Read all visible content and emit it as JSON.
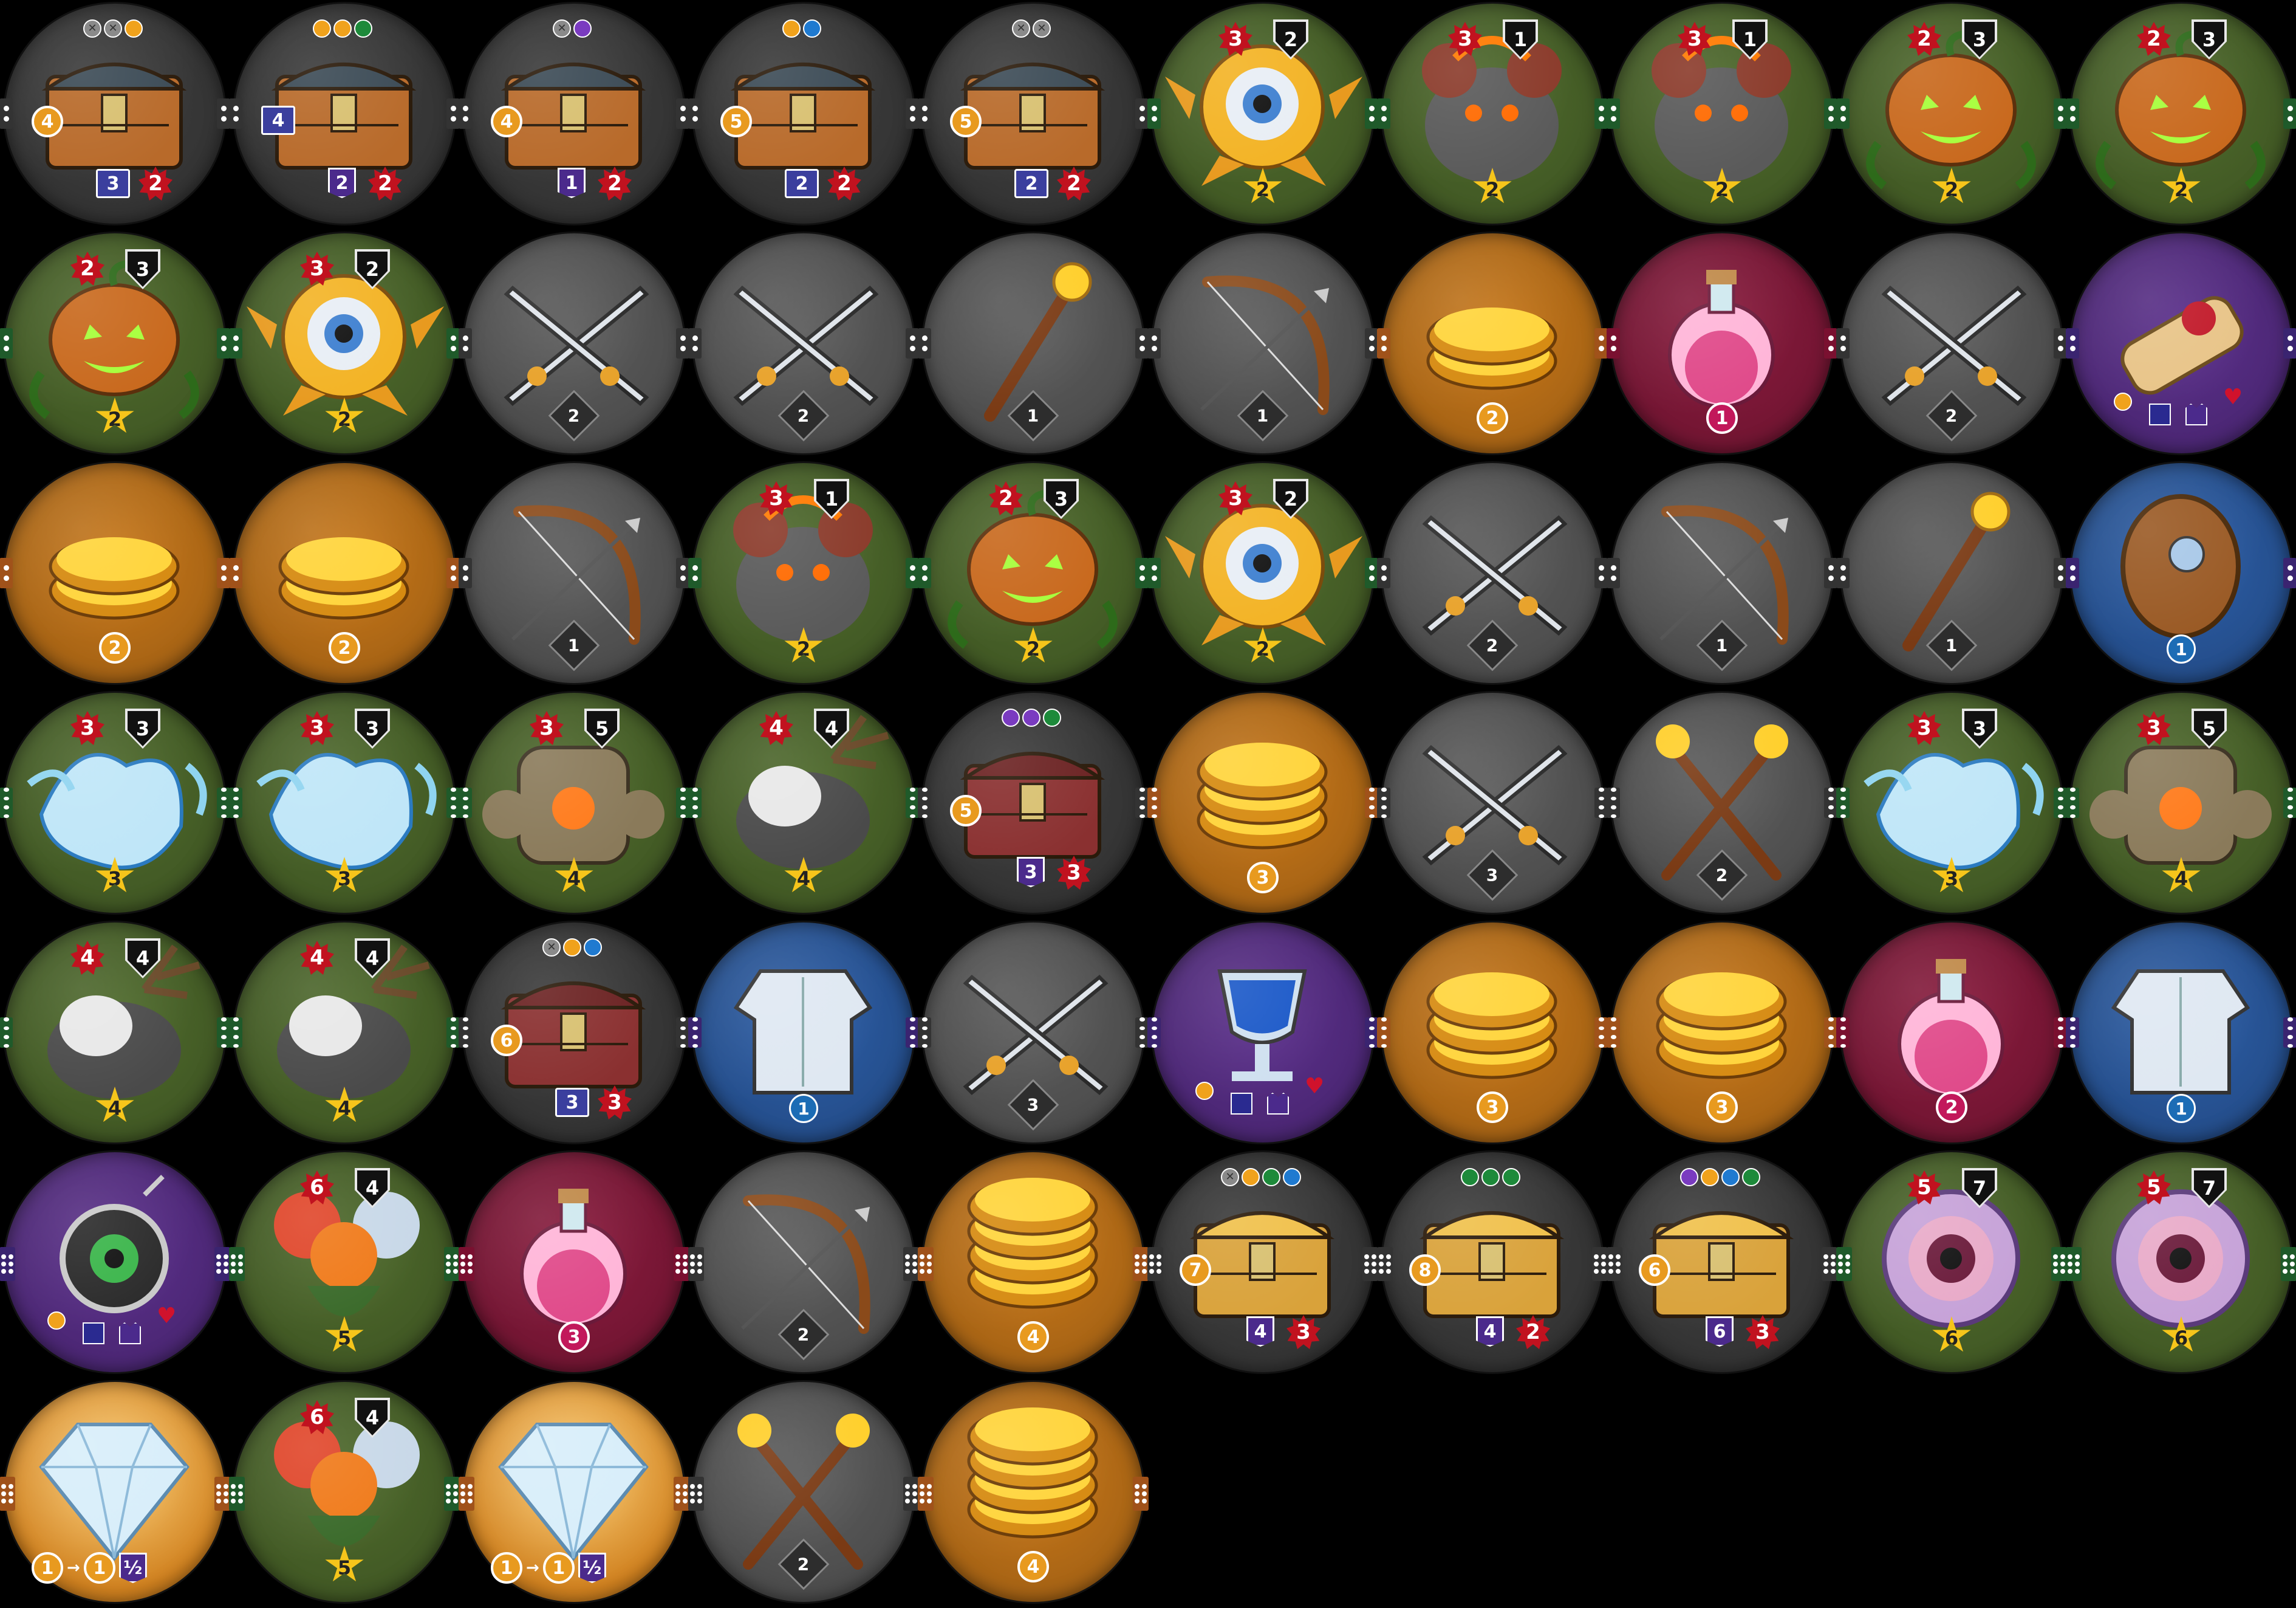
{
  "colors": {
    "monster": "#4f6b2c",
    "weapon": "#5c5c5c",
    "coin": "#c97819",
    "potion": "#8a1a3d",
    "magic": "#5b2f8c",
    "armor": "#2c5ea8",
    "chest": "#3e3e3e",
    "gem": "#d0811f"
  },
  "tokens": [
    {
      "type": "chest",
      "label": "treasure-chest",
      "icon": "chest-icon",
      "edge": "2",
      "coins": [
        "gray-x",
        "gray-x",
        "orange"
      ],
      "cost": "4",
      "book": "3",
      "dmg": "2"
    },
    {
      "type": "chest",
      "label": "treasure-chest",
      "icon": "chest-icon",
      "edge": "2",
      "coins": [
        "orange",
        "orange",
        "green"
      ],
      "cost": "4",
      "shield": "2",
      "dmg": "2",
      "costStyle": "blue"
    },
    {
      "type": "chest",
      "label": "treasure-chest",
      "icon": "chest-icon",
      "edge": "2",
      "coins": [
        "gray-x",
        "purple"
      ],
      "cost": "4",
      "shield": "1",
      "dmg": "2"
    },
    {
      "type": "chest",
      "label": "treasure-chest",
      "icon": "chest-icon",
      "edge": "2",
      "coins": [
        "orange",
        "blue"
      ],
      "cost": "5",
      "book": "2",
      "dmg": "2"
    },
    {
      "type": "chest",
      "label": "treasure-chest",
      "icon": "chest-icon",
      "edge": "2",
      "coins": [
        "gray-x",
        "gray-x"
      ],
      "cost": "5",
      "book": "2",
      "dmg": "2"
    },
    {
      "type": "monster",
      "label": "eyeball-monster",
      "icon": "eyeball-icon",
      "edge": "2",
      "atk": "3",
      "def": "2",
      "star": "2"
    },
    {
      "type": "monster",
      "label": "fire-rat-monster",
      "icon": "rat-icon",
      "edge": "2",
      "atk": "3",
      "def": "1",
      "star": "2"
    },
    {
      "type": "monster",
      "label": "fire-rat-monster",
      "icon": "rat-icon",
      "edge": "2",
      "atk": "3",
      "def": "1",
      "star": "2"
    },
    {
      "type": "monster",
      "label": "pumpkin-monster",
      "icon": "pumpkin-icon",
      "edge": "2",
      "atk": "2",
      "def": "3",
      "star": "2"
    },
    {
      "type": "monster",
      "label": "pumpkin-monster",
      "icon": "pumpkin-icon",
      "edge": "2",
      "atk": "2",
      "def": "3",
      "star": "2"
    },
    {
      "type": "monster",
      "label": "pumpkin-monster",
      "icon": "pumpkin-icon",
      "edge": "2",
      "atk": "2",
      "def": "3",
      "star": "2"
    },
    {
      "type": "monster",
      "label": "eyeball-monster",
      "icon": "eyeball-icon",
      "edge": "2",
      "atk": "3",
      "def": "2",
      "star": "2"
    },
    {
      "type": "weapon",
      "label": "crossed-swords",
      "icon": "swords-icon",
      "edge": "2",
      "power": "2"
    },
    {
      "type": "weapon",
      "label": "crossed-swords",
      "icon": "swords-icon",
      "edge": "2",
      "power": "2"
    },
    {
      "type": "weapon",
      "label": "magic-staff",
      "icon": "staff-icon",
      "edge": "2",
      "power": "1"
    },
    {
      "type": "weapon",
      "label": "bow",
      "icon": "bow-icon",
      "edge": "2",
      "power": "1"
    },
    {
      "type": "coin",
      "label": "gold-coins",
      "icon": "coins-icon",
      "edge": "2",
      "value": "2"
    },
    {
      "type": "potion",
      "label": "health-potion",
      "icon": "potion-icon",
      "edge": "2",
      "value": "1"
    },
    {
      "type": "weapon",
      "label": "crossed-swords",
      "icon": "swords-icon",
      "edge": "2",
      "power": "2"
    },
    {
      "type": "magic",
      "label": "scroll",
      "icon": "scroll-icon",
      "edge": "2",
      "magicRow": true
    },
    {
      "type": "coin",
      "label": "gold-coins",
      "icon": "coins-icon",
      "edge": "2",
      "value": "2"
    },
    {
      "type": "coin",
      "label": "gold-coins",
      "icon": "coins-icon",
      "edge": "2",
      "value": "2"
    },
    {
      "type": "weapon",
      "label": "bow",
      "icon": "bow-icon",
      "edge": "2",
      "power": "1"
    },
    {
      "type": "monster",
      "label": "fire-rat-monster",
      "icon": "rat-icon",
      "edge": "2",
      "atk": "3",
      "def": "1",
      "star": "2"
    },
    {
      "type": "monster",
      "label": "pumpkin-monster",
      "icon": "pumpkin-icon",
      "edge": "2",
      "atk": "2",
      "def": "3",
      "star": "2"
    },
    {
      "type": "monster",
      "label": "eyeball-monster",
      "icon": "eyeball-icon",
      "edge": "2",
      "atk": "3",
      "def": "2",
      "star": "2"
    },
    {
      "type": "weapon",
      "label": "crossed-swords",
      "icon": "swords-icon",
      "edge": "2",
      "power": "2"
    },
    {
      "type": "weapon",
      "label": "bow",
      "icon": "bow-icon",
      "edge": "2",
      "power": "1"
    },
    {
      "type": "weapon",
      "label": "magic-staff",
      "icon": "staff-icon",
      "edge": "2",
      "power": "1"
    },
    {
      "type": "armor",
      "label": "wooden-shield",
      "icon": "shield-icon",
      "edge": "2",
      "value": "1"
    },
    {
      "type": "monster",
      "label": "water-spirit-monster",
      "icon": "water-spirit-icon",
      "edge": "4",
      "atk": "3",
      "def": "3",
      "star": "3"
    },
    {
      "type": "monster",
      "label": "water-spirit-monster",
      "icon": "water-spirit-icon",
      "edge": "4",
      "atk": "3",
      "def": "3",
      "star": "3"
    },
    {
      "type": "monster",
      "label": "rock-golem-monster",
      "icon": "golem-icon",
      "edge": "4",
      "atk": "3",
      "def": "5",
      "star": "4"
    },
    {
      "type": "monster",
      "label": "antler-beast-monster",
      "icon": "beast-icon",
      "edge": "4",
      "atk": "4",
      "def": "4",
      "star": "4"
    },
    {
      "type": "chest",
      "label": "treasure-chest",
      "icon": "chest-icon",
      "edge": "4",
      "coins": [
        "purple",
        "purple",
        "green"
      ],
      "cost": "5",
      "shield": "3",
      "dmg": "3",
      "red": true
    },
    {
      "type": "coin",
      "label": "gold-coins",
      "icon": "coins-icon",
      "edge": "4",
      "value": "3"
    },
    {
      "type": "weapon",
      "label": "crossed-swords",
      "icon": "swords-icon",
      "edge": "4",
      "power": "3"
    },
    {
      "type": "weapon",
      "label": "crossed-staffs",
      "icon": "staffs-icon",
      "edge": "4",
      "power": "2"
    },
    {
      "type": "monster",
      "label": "water-spirit-monster",
      "icon": "water-spirit-icon",
      "edge": "4",
      "atk": "3",
      "def": "3",
      "star": "3"
    },
    {
      "type": "monster",
      "label": "rock-golem-monster",
      "icon": "golem-icon",
      "edge": "4",
      "atk": "3",
      "def": "5",
      "star": "4"
    },
    {
      "type": "monster",
      "label": "antler-beast-monster",
      "icon": "beast-icon",
      "edge": "4",
      "atk": "4",
      "def": "4",
      "star": "4"
    },
    {
      "type": "monster",
      "label": "antler-beast-monster",
      "icon": "beast-icon",
      "edge": "4",
      "atk": "4",
      "def": "4",
      "star": "4"
    },
    {
      "type": "chest",
      "label": "treasure-chest",
      "icon": "chest-icon",
      "edge": "4",
      "coins": [
        "gray-x",
        "orange",
        "blue"
      ],
      "cost": "6",
      "book": "3",
      "dmg": "3",
      "red": true
    },
    {
      "type": "armor",
      "label": "chest-armor",
      "icon": "armor-icon",
      "edge": "4",
      "value": "1"
    },
    {
      "type": "weapon",
      "label": "crossed-swords",
      "icon": "swords-icon",
      "edge": "4",
      "power": "3"
    },
    {
      "type": "magic",
      "label": "silver-goblet",
      "icon": "goblet-icon",
      "edge": "4",
      "magicRow": true
    },
    {
      "type": "coin",
      "label": "gold-coins",
      "icon": "coins-icon",
      "edge": "4",
      "value": "3"
    },
    {
      "type": "coin",
      "label": "gold-coins",
      "icon": "coins-icon",
      "edge": "4",
      "value": "3"
    },
    {
      "type": "potion",
      "label": "health-potions",
      "icon": "potion-icon",
      "edge": "4",
      "value": "2"
    },
    {
      "type": "armor",
      "label": "chest-armor",
      "icon": "armor-icon",
      "edge": "4",
      "value": "1"
    },
    {
      "type": "magic",
      "label": "amulet",
      "icon": "amulet-icon",
      "edge": "6",
      "magicRow": true
    },
    {
      "type": "monster",
      "label": "fire-ice-beast-monster",
      "icon": "hydra-icon",
      "edge": "6",
      "atk": "6",
      "def": "4",
      "star": "5"
    },
    {
      "type": "potion",
      "label": "health-potions",
      "icon": "potion-icon",
      "edge": "6",
      "value": "3"
    },
    {
      "type": "weapon",
      "label": "bow",
      "icon": "bow-icon",
      "edge": "6",
      "power": "2"
    },
    {
      "type": "coin",
      "label": "gold-coins",
      "icon": "coins-icon",
      "edge": "6",
      "value": "4"
    },
    {
      "type": "chest",
      "label": "treasure-chest",
      "icon": "chest-icon",
      "edge": "6",
      "coins": [
        "gray-x",
        "orange",
        "green",
        "blue"
      ],
      "cost": "7",
      "shield": "4",
      "dmg": "3",
      "gold": true
    },
    {
      "type": "chest",
      "label": "treasure-chest",
      "icon": "chest-icon",
      "edge": "6",
      "coins": [
        "green",
        "green",
        "green"
      ],
      "cost": "8",
      "shield": "4",
      "dmg": "2",
      "gold": true
    },
    {
      "type": "chest",
      "label": "treasure-chest",
      "icon": "chest-icon",
      "edge": "6",
      "coins": [
        "purple",
        "orange",
        "blue",
        "green"
      ],
      "cost": "6",
      "shield": "6",
      "dmg": "3",
      "gold": true
    },
    {
      "type": "monster",
      "label": "worm-maw-monster",
      "icon": "worm-icon",
      "edge": "6",
      "atk": "5",
      "def": "7",
      "star": "6"
    },
    {
      "type": "monster",
      "label": "worm-maw-monster",
      "icon": "worm-icon",
      "edge": "6",
      "atk": "5",
      "def": "7",
      "star": "6"
    },
    {
      "type": "gem",
      "label": "diamond",
      "icon": "diamond-icon",
      "edge": "6",
      "conv": [
        "1",
        "1",
        "½"
      ]
    },
    {
      "type": "monster",
      "label": "fire-ice-beast-monster",
      "icon": "hydra-icon",
      "edge": "6",
      "atk": "6",
      "def": "4",
      "star": "5"
    },
    {
      "type": "gem",
      "label": "diamond",
      "icon": "diamond-icon",
      "edge": "6",
      "conv": [
        "1",
        "1",
        "½"
      ]
    },
    {
      "type": "weapon",
      "label": "crossed-staffs",
      "icon": "staffs-icon",
      "edge": "6",
      "power": "2"
    },
    {
      "type": "coin",
      "label": "gold-coins",
      "icon": "coins-icon",
      "edge": "6",
      "value": "4"
    }
  ]
}
